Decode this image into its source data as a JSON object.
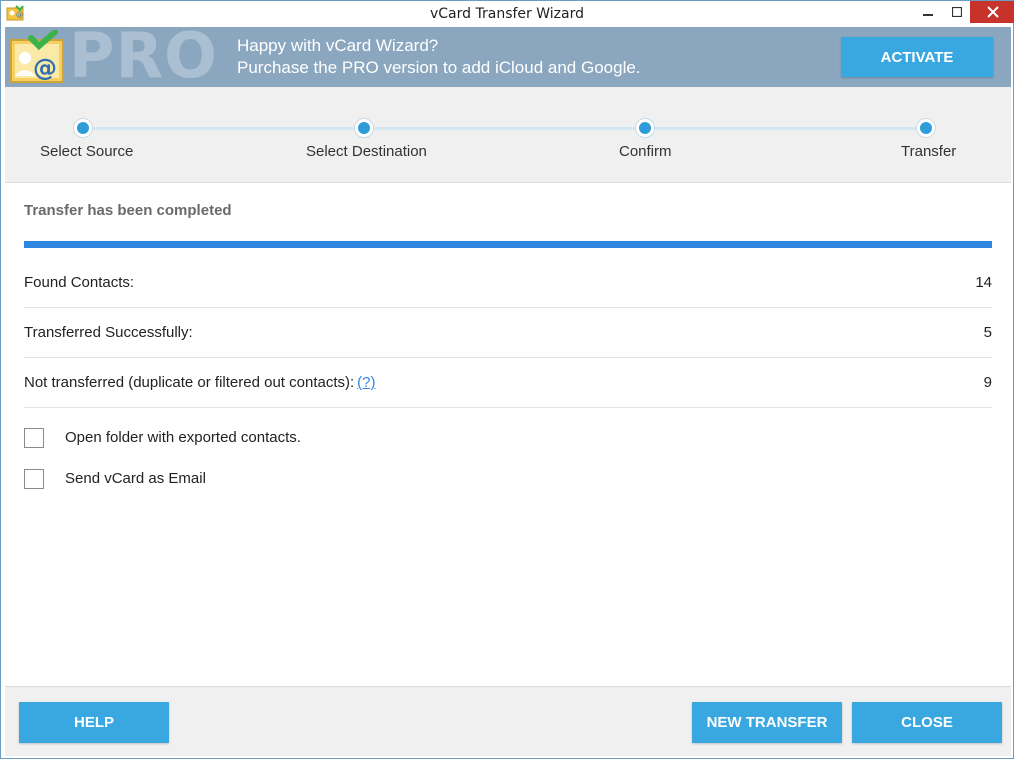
{
  "window": {
    "title": "vCard Transfer Wizard"
  },
  "banner": {
    "pro_label": "PRO",
    "line1": "Happy with vCard Wizard?",
    "line2": "Purchase the PRO version to add iCloud and Google.",
    "activate_label": "ACTIVATE",
    "accent": "#3aa8e0",
    "background": "#8aa7bf"
  },
  "steps": [
    {
      "label": "Select Source"
    },
    {
      "label": "Select Destination"
    },
    {
      "label": "Confirm"
    },
    {
      "label": "Transfer"
    }
  ],
  "status": {
    "message": "Transfer has been completed",
    "progress_percent": 100
  },
  "results": [
    {
      "label": "Found Contacts:",
      "value": "14"
    },
    {
      "label": "Transferred Successfully:",
      "value": "5"
    },
    {
      "label": "Not transferred (duplicate or filtered out contacts):",
      "help": "(?)",
      "value": "9"
    }
  ],
  "options": [
    {
      "label": "Open folder with exported contacts.",
      "checked": false
    },
    {
      "label": "Send vCard as Email",
      "checked": false
    }
  ],
  "footer": {
    "help_label": "HELP",
    "new_transfer_label": "NEW TRANSFER",
    "close_label": "CLOSE"
  },
  "icons": {
    "app": "vcard-app-icon",
    "minimize": "minimize-icon",
    "maximize": "maximize-icon",
    "close": "close-icon"
  }
}
